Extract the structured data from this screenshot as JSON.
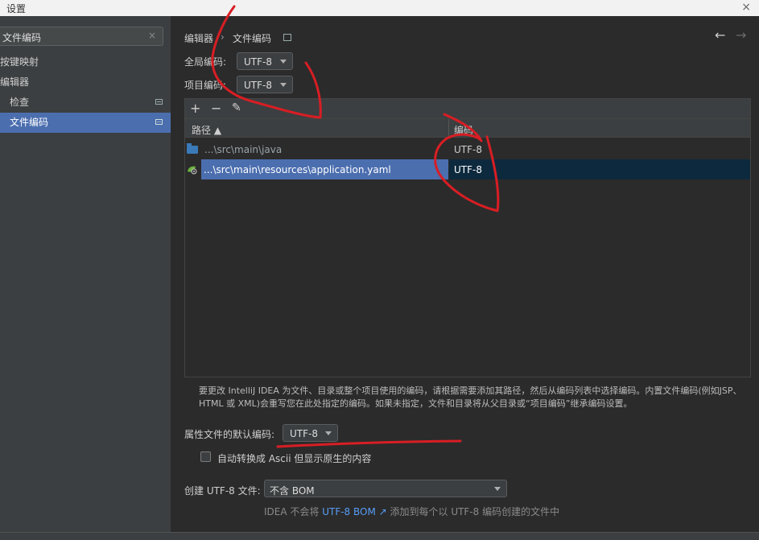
{
  "window": {
    "title": "设置",
    "close": "×"
  },
  "sidebar": {
    "search": {
      "value": "文件编码",
      "clear": "×"
    },
    "items": [
      {
        "label": "按键映射"
      },
      {
        "label": "编辑器"
      },
      {
        "label": "检查"
      },
      {
        "label": "文件编码",
        "selected": true
      }
    ]
  },
  "header": {
    "breadcrumb": [
      "编辑器",
      "›",
      "文件编码"
    ],
    "back": "←",
    "forward": "→"
  },
  "global_encoding": {
    "label": "全局编码:",
    "value": "UTF-8"
  },
  "project_encoding": {
    "label": "项目编码:",
    "value": "UTF-8"
  },
  "table": {
    "toolbar": {
      "add": "+",
      "remove": "−",
      "edit": "✎"
    },
    "columns": [
      "路径 ▲",
      "编码"
    ],
    "rows": [
      {
        "path": "...\\src\\main\\java",
        "encoding": "UTF-8"
      },
      {
        "path": "...\\src\\main\\resources\\application.yaml",
        "encoding": "UTF-8",
        "selected": true
      }
    ]
  },
  "help_text": "要更改 IntelliJ IDEA 为文件、目录或整个项目使用的编码，请根据需要添加其路径，然后从编码列表中选择编码。内置文件编码(例如JSP、HTML 或 XML)会重写您在此处指定的编码。如果未指定，文件和目录将从父目录或“项目编码”继承编码设置。",
  "properties": {
    "label": "属性文件的默认编码:",
    "value": "UTF-8"
  },
  "ascii_checkbox": {
    "label": "自动转换成 Ascii 但显示原生的内容",
    "checked": false
  },
  "bom": {
    "label": "创建 UTF-8 文件:",
    "value": "不含 BOM"
  },
  "bom_hint": {
    "prefix": "IDEA 不会将 ",
    "link": "UTF-8 BOM ↗",
    "suffix": " 添加到每个以 UTF-8 编码创建的文件中"
  },
  "colors": {
    "accent": "#4b6eaf",
    "selected_row": "#0d293e",
    "link": "#589df6",
    "annotation": "#d81e24"
  }
}
